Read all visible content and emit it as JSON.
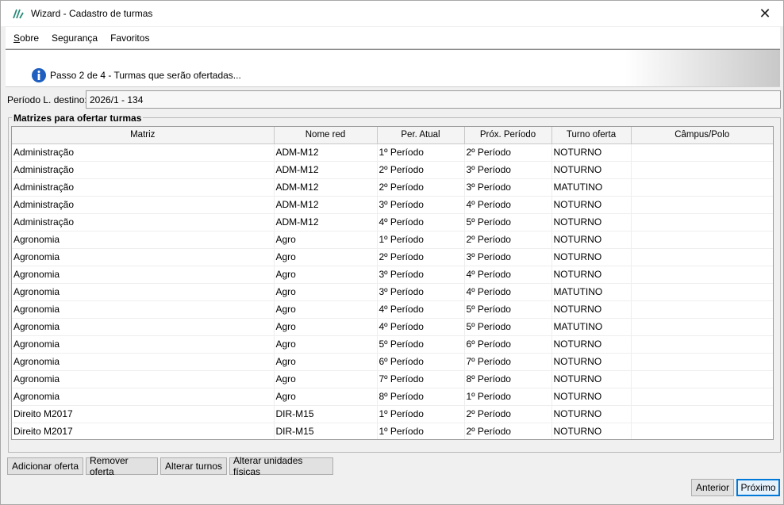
{
  "window": {
    "title": "Wizard - Cadastro de turmas",
    "close_label": "✕"
  },
  "menu": {
    "items": [
      {
        "label": "Sobre",
        "first": "S",
        "rest": "obre"
      },
      {
        "label": "Segurança"
      },
      {
        "label": "Favoritos"
      }
    ]
  },
  "step": {
    "text": "Passo 2 de 4 - Turmas que serão ofertadas..."
  },
  "periodo": {
    "label": "Período L. destino:",
    "value": "2026/1 - 134"
  },
  "group": {
    "title": "Matrizes para ofertar turmas"
  },
  "table": {
    "columns": [
      "Matriz",
      "Nome red",
      "Per. Atual",
      "Próx. Período",
      "Turno oferta",
      "Câmpus/Polo"
    ],
    "rows": [
      [
        "Administração",
        "ADM-M12",
        "1º Período",
        "2º Período",
        "NOTURNO",
        ""
      ],
      [
        "Administração",
        "ADM-M12",
        "2º Período",
        "3º Período",
        "NOTURNO",
        ""
      ],
      [
        "Administração",
        "ADM-M12",
        "2º Período",
        "3º Período",
        "MATUTINO",
        ""
      ],
      [
        "Administração",
        "ADM-M12",
        "3º Período",
        "4º Período",
        "NOTURNO",
        ""
      ],
      [
        "Administração",
        "ADM-M12",
        "4º Período",
        "5º Período",
        "NOTURNO",
        ""
      ],
      [
        "Agronomia",
        "Agro",
        "1º Período",
        "2º Período",
        "NOTURNO",
        ""
      ],
      [
        "Agronomia",
        "Agro",
        "2º Período",
        "3º Período",
        "NOTURNO",
        ""
      ],
      [
        "Agronomia",
        "Agro",
        "3º Período",
        "4º Período",
        "NOTURNO",
        ""
      ],
      [
        "Agronomia",
        "Agro",
        "3º Período",
        "4º Período",
        "MATUTINO",
        ""
      ],
      [
        "Agronomia",
        "Agro",
        "4º Período",
        "5º Período",
        "NOTURNO",
        ""
      ],
      [
        "Agronomia",
        "Agro",
        "4º Período",
        "5º Período",
        "MATUTINO",
        ""
      ],
      [
        "Agronomia",
        "Agro",
        "5º Período",
        "6º Período",
        "NOTURNO",
        ""
      ],
      [
        "Agronomia",
        "Agro",
        "6º Período",
        "7º Período",
        "NOTURNO",
        ""
      ],
      [
        "Agronomia",
        "Agro",
        "7º Período",
        "8º Período",
        "NOTURNO",
        ""
      ],
      [
        "Agronomia",
        "Agro",
        "8º Período",
        "1º Período",
        "NOTURNO",
        ""
      ],
      [
        "Direito M2017",
        "DIR-M15",
        "1º Período",
        "2º Período",
        "NOTURNO",
        ""
      ],
      [
        "Direito M2017",
        "DIR-M15",
        "1º Período",
        "2º Período",
        "NOTURNO",
        ""
      ]
    ]
  },
  "actions": {
    "adicionar": "Adicionar oferta",
    "remover": "Remover oferta",
    "alterar_turnos": "Alterar turnos",
    "alterar_unidades": "Alterar unidades físicas"
  },
  "nav": {
    "anterior": "Anterior",
    "proximo": "Próximo"
  },
  "colors": {
    "accent": "#0078d7",
    "info_icon": "#1f5fbf"
  }
}
